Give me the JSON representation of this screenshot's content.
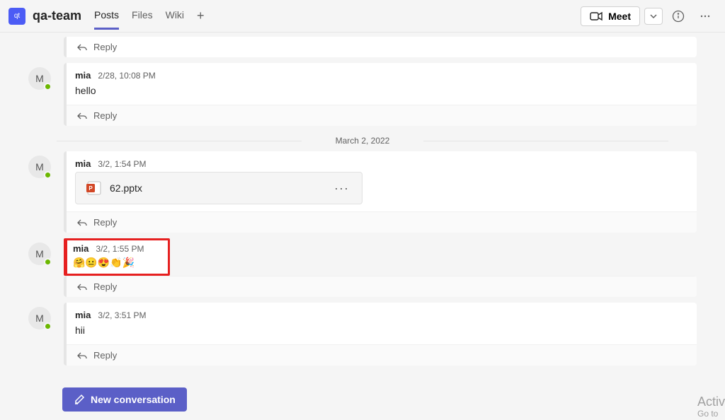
{
  "header": {
    "team_badge": "qt",
    "team_name": "qa-team",
    "tabs": [
      {
        "label": "Posts",
        "active": true
      },
      {
        "label": "Files",
        "active": false
      },
      {
        "label": "Wiki",
        "active": false
      }
    ],
    "meet_label": "Meet"
  },
  "date_separator": "March 2, 2022",
  "messages": [
    {
      "id": "m0",
      "avatar_initial": "M",
      "author": "mia",
      "time": "2/28, 10:08 PM",
      "text": "hello",
      "reply_label": "Reply"
    },
    {
      "id": "m1",
      "avatar_initial": "M",
      "author": "mia",
      "time": "3/2, 1:54 PM",
      "file": {
        "name": "62.pptx"
      },
      "reply_label": "Reply"
    },
    {
      "id": "m2",
      "avatar_initial": "M",
      "author": "mia",
      "time": "3/2, 1:55 PM",
      "emojis": "🤗😐😍👏🎉",
      "highlighted": true,
      "reply_label": "Reply"
    },
    {
      "id": "m3",
      "avatar_initial": "M",
      "author": "mia",
      "time": "3/2, 3:51 PM",
      "text": "hii",
      "reply_label": "Reply"
    }
  ],
  "orphan_reply_label": "Reply",
  "new_conversation_label": "New conversation",
  "watermark_line1": "Activ",
  "watermark_line2": "Go to"
}
